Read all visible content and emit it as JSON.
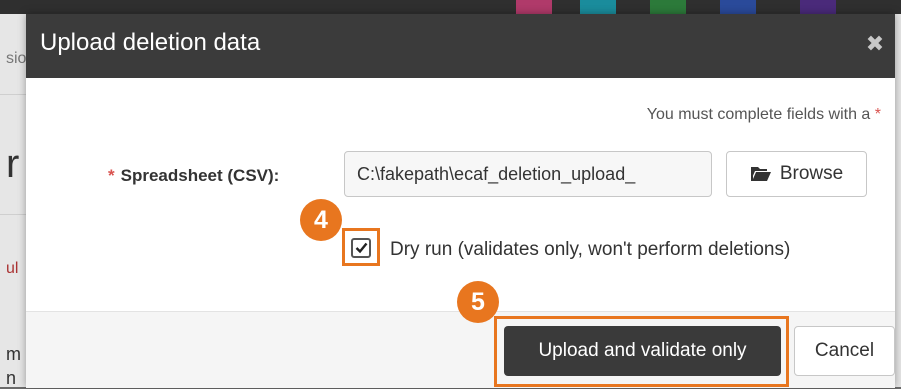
{
  "background_page": {
    "snippets": [
      "sio",
      "r",
      "ul",
      "m",
      "n"
    ],
    "swatch_colors": [
      "#b03a6a",
      "#1a8c9c",
      "#2c7a3a",
      "#2a4a9a",
      "#4a2a7a"
    ]
  },
  "modal": {
    "title": "Upload deletion data",
    "close_icon": "close-icon",
    "required_note": "You must complete fields with a",
    "required_star": "*",
    "spreadsheet": {
      "label": "Spreadsheet (CSV):",
      "value": "C:\\fakepath\\ecaf_deletion_upload_",
      "browse_label": "Browse",
      "browse_icon": "folder-open-icon"
    },
    "dry_run": {
      "checked": true,
      "label": "Dry run (validates only, won't perform deletions)"
    },
    "footer": {
      "upload_label": "Upload and validate only",
      "cancel_label": "Cancel"
    }
  },
  "annotations": {
    "step_4": "4",
    "step_5": "5",
    "highlight_color": "#e8761f"
  }
}
